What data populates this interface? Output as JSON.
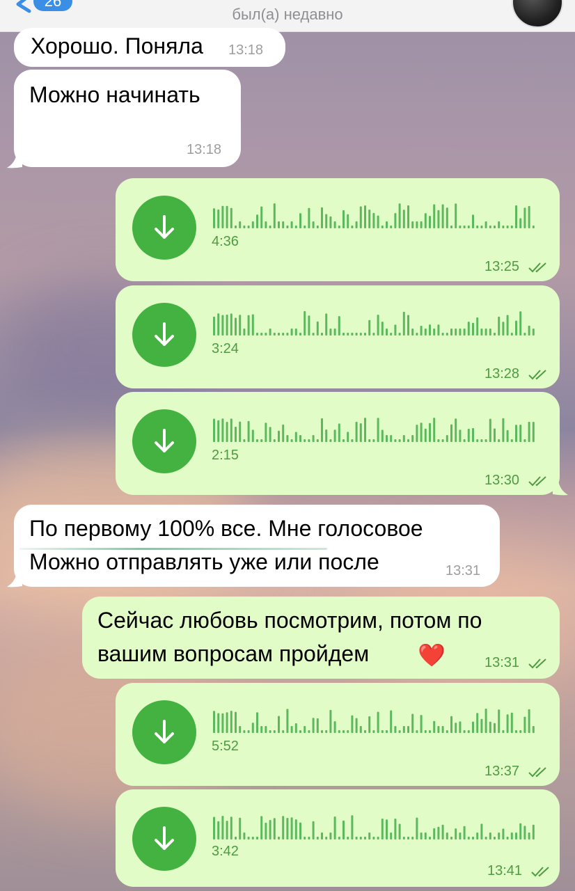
{
  "header": {
    "badge_count": "26",
    "status": "был(а) недавно"
  },
  "messages": [
    {
      "direction": "in",
      "text": "Хорошо. Поняла",
      "time": "13:18"
    },
    {
      "direction": "in",
      "text": "Можно начинать",
      "time": "13:18"
    },
    {
      "direction": "out",
      "type": "voice",
      "duration": "4:36",
      "time": "13:25",
      "read": true
    },
    {
      "direction": "out",
      "type": "voice",
      "duration": "3:24",
      "time": "13:28",
      "read": true
    },
    {
      "direction": "out",
      "type": "voice",
      "duration": "2:15",
      "time": "13:30",
      "read": true
    },
    {
      "direction": "in",
      "lines": [
        "По первому 100% все. Мне голосовое",
        "Можно отправлять уже или после"
      ],
      "time": "13:31"
    },
    {
      "direction": "out",
      "lines": [
        "Сейчас любовь посмотрим, потом по",
        "вашим вопросам пройдем"
      ],
      "emoji": "❤️",
      "time": "13:31",
      "read": true
    },
    {
      "direction": "out",
      "type": "voice",
      "duration": "5:52",
      "time": "13:37",
      "read": true
    },
    {
      "direction": "out",
      "type": "voice",
      "duration": "3:42",
      "time": "13:41",
      "read": true
    }
  ],
  "icons": {
    "back": "chevron-left-icon",
    "voice_download": "download-arrow-icon",
    "read_receipt": "double-check-icon"
  },
  "colors": {
    "incoming_bubble": "#ffffff",
    "outgoing_bubble": "#e2fcc8",
    "voice_button": "#44b240",
    "accent_text": "#4e9b41",
    "badge": "#3a8ee6"
  }
}
